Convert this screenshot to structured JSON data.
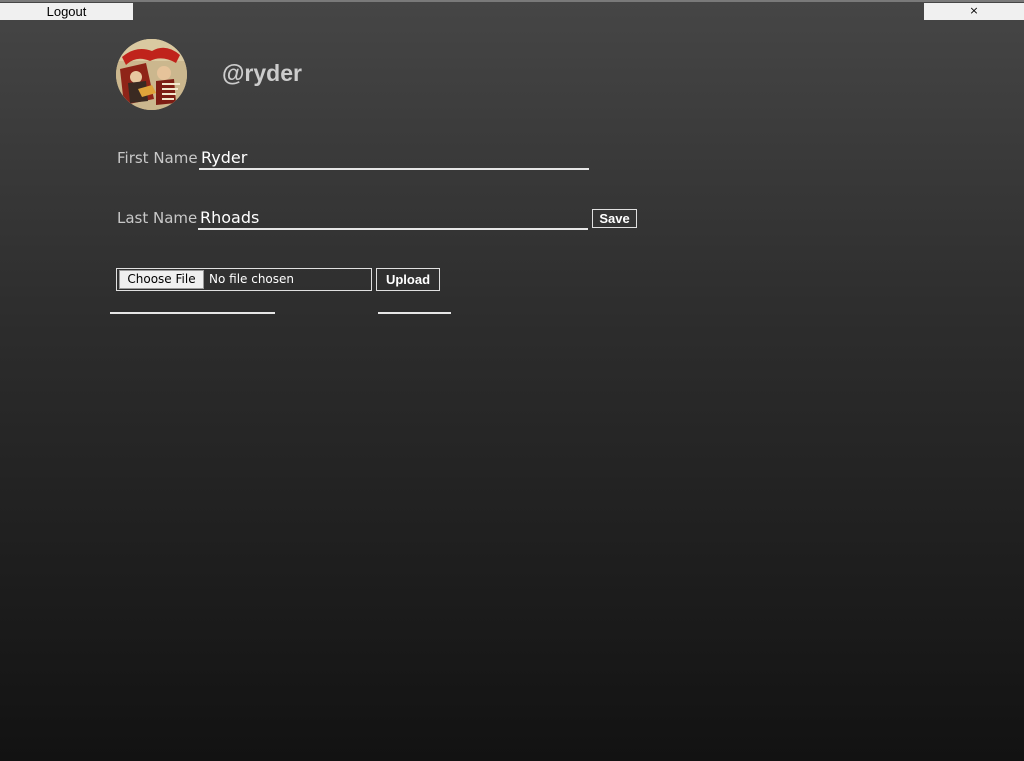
{
  "header": {
    "logout_label": "Logout",
    "close_label": "×"
  },
  "profile": {
    "handle": "@ryder",
    "avatar_icon": "profile-picture"
  },
  "form": {
    "first_name": {
      "label": "First Name",
      "value": "Ryder"
    },
    "last_name": {
      "label": "Last Name",
      "value": "Rhoads"
    },
    "save_label": "Save"
  },
  "upload": {
    "choose_label": "Choose File",
    "status": "No file chosen",
    "upload_label": "Upload"
  },
  "colors": {
    "background_top": "#464646",
    "background_bottom": "#121212",
    "text": "#cfcfcf",
    "input_underline": "#e6e6e6"
  }
}
